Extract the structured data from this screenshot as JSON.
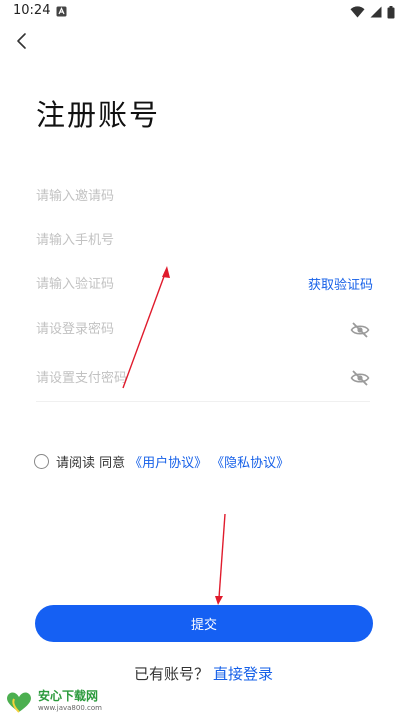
{
  "status_bar": {
    "time": "10:24",
    "icons": [
      "app-notification-icon",
      "wifi-icon",
      "signal-icon",
      "battery-icon"
    ]
  },
  "nav": {
    "back_icon": "chevron-left-icon"
  },
  "title": "注册账号",
  "form": {
    "invite_code": {
      "placeholder": "请输入邀请码",
      "value": ""
    },
    "phone": {
      "placeholder": "请输入手机号",
      "value": ""
    },
    "verify_code": {
      "placeholder": "请输入验证码",
      "value": "",
      "action_label": "获取验证码"
    },
    "login_password": {
      "placeholder": "请设登录密码",
      "value": "",
      "toggle_icon": "eye-off-icon"
    },
    "pay_password": {
      "placeholder": "请设置支付密码",
      "value": "",
      "toggle_icon": "eye-off-icon"
    }
  },
  "agreement": {
    "prefix": "请阅读 同意",
    "user_agreement": "《用户协议》",
    "privacy_agreement": "《隐私协议》",
    "checked": false
  },
  "submit_label": "提交",
  "login_prompt": {
    "text": "已有账号？",
    "link": "直接登录"
  },
  "watermark": {
    "brand": "安心下载网",
    "url": "www.java800.com"
  },
  "colors": {
    "accent": "#1560f3",
    "link": "#1660e8",
    "annotation_arrow": "#e01b2c"
  }
}
